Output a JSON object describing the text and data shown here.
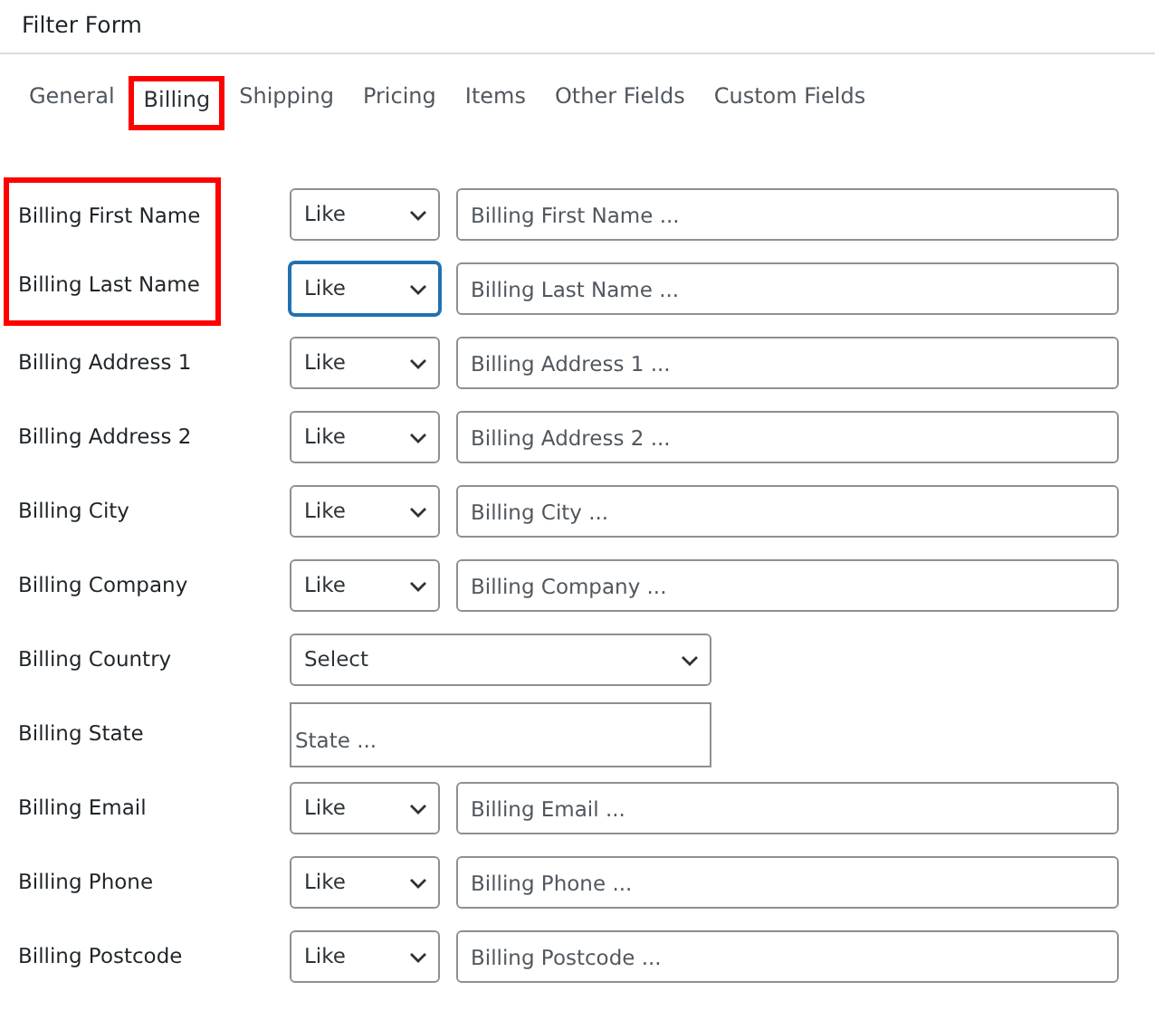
{
  "title": "Filter Form",
  "tabs": [
    {
      "label": "General",
      "selected": false,
      "highlighted": false
    },
    {
      "label": "Billing",
      "selected": true,
      "highlighted": true
    },
    {
      "label": "Shipping",
      "selected": false,
      "highlighted": false
    },
    {
      "label": "Pricing",
      "selected": false,
      "highlighted": false
    },
    {
      "label": "Items",
      "selected": false,
      "highlighted": false
    },
    {
      "label": "Other Fields",
      "selected": false,
      "highlighted": false
    },
    {
      "label": "Custom Fields",
      "selected": false,
      "highlighted": false
    }
  ],
  "rows": [
    {
      "kind": "match",
      "label": "Billing First Name",
      "operator": "Like",
      "placeholder": "Billing First Name ...",
      "focused": false,
      "highlighted": true
    },
    {
      "kind": "match",
      "label": "Billing Last Name",
      "operator": "Like",
      "placeholder": "Billing Last Name ...",
      "focused": true,
      "highlighted": true
    },
    {
      "kind": "match",
      "label": "Billing Address 1",
      "operator": "Like",
      "placeholder": "Billing Address 1 ...",
      "focused": false,
      "highlighted": false
    },
    {
      "kind": "match",
      "label": "Billing Address 2",
      "operator": "Like",
      "placeholder": "Billing Address 2 ...",
      "focused": false,
      "highlighted": false
    },
    {
      "kind": "match",
      "label": "Billing City",
      "operator": "Like",
      "placeholder": "Billing City ...",
      "focused": false,
      "highlighted": false
    },
    {
      "kind": "match",
      "label": "Billing Company",
      "operator": "Like",
      "placeholder": "Billing Company ...",
      "focused": false,
      "highlighted": false
    },
    {
      "kind": "select",
      "label": "Billing Country",
      "value": "Select",
      "focused": false,
      "highlighted": false
    },
    {
      "kind": "text",
      "label": "Billing State",
      "placeholder": "State ...",
      "focused": false,
      "highlighted": false
    },
    {
      "kind": "match",
      "label": "Billing Email",
      "operator": "Like",
      "placeholder": "Billing Email ...",
      "focused": false,
      "highlighted": false
    },
    {
      "kind": "match",
      "label": "Billing Phone",
      "operator": "Like",
      "placeholder": "Billing Phone ...",
      "focused": false,
      "highlighted": false
    },
    {
      "kind": "match",
      "label": "Billing Postcode",
      "operator": "Like",
      "placeholder": "Billing Postcode ...",
      "focused": false,
      "highlighted": false
    }
  ]
}
